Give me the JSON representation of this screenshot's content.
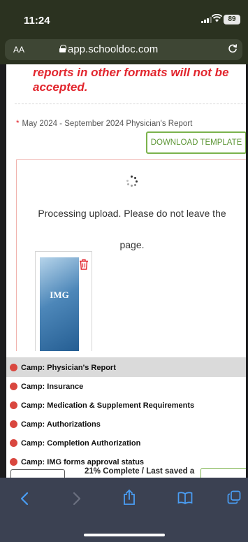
{
  "status_bar": {
    "time": "11:24",
    "battery": "89"
  },
  "browser": {
    "text_size_label": "AA",
    "url": "app.schooldoc.com"
  },
  "page": {
    "warning": "reports in other formats will not be accepted.",
    "required_marker": "*",
    "report_label": "May 2024 - September 2024 Physician's Report",
    "download_button": "DOWNLOAD TEMPLATE",
    "processing_line1": "Processing upload. Please do not leave the",
    "processing_line2": "page.",
    "thumbnail_logo": "IMG"
  },
  "checklist": [
    {
      "label": "Camp: Physician's Report",
      "status_color": "#d9473f",
      "selected": true
    },
    {
      "label": "Camp: Insurance",
      "status_color": "#d9473f",
      "selected": false
    },
    {
      "label": "Camp: Medication & Supplement Requirements",
      "status_color": "#d9473f",
      "selected": false
    },
    {
      "label": "Camp: Authorizations",
      "status_color": "#d9473f",
      "selected": false
    },
    {
      "label": "Camp: Completion Authorization",
      "status_color": "#d9473f",
      "selected": false
    },
    {
      "label": "Camp: IMG forms approval status",
      "status_color": "#d9473f",
      "selected": false
    }
  ],
  "progress": {
    "text": "21% Complete / Last saved a"
  },
  "colors": {
    "accent_red": "#e2262e",
    "accent_green": "#7bb24c",
    "browser_chrome": "#2b3220",
    "toolbar": "#3b4152"
  },
  "toolbar": {
    "icons": [
      "back-icon",
      "forward-icon",
      "share-icon",
      "bookmarks-icon",
      "tabs-icon"
    ]
  }
}
